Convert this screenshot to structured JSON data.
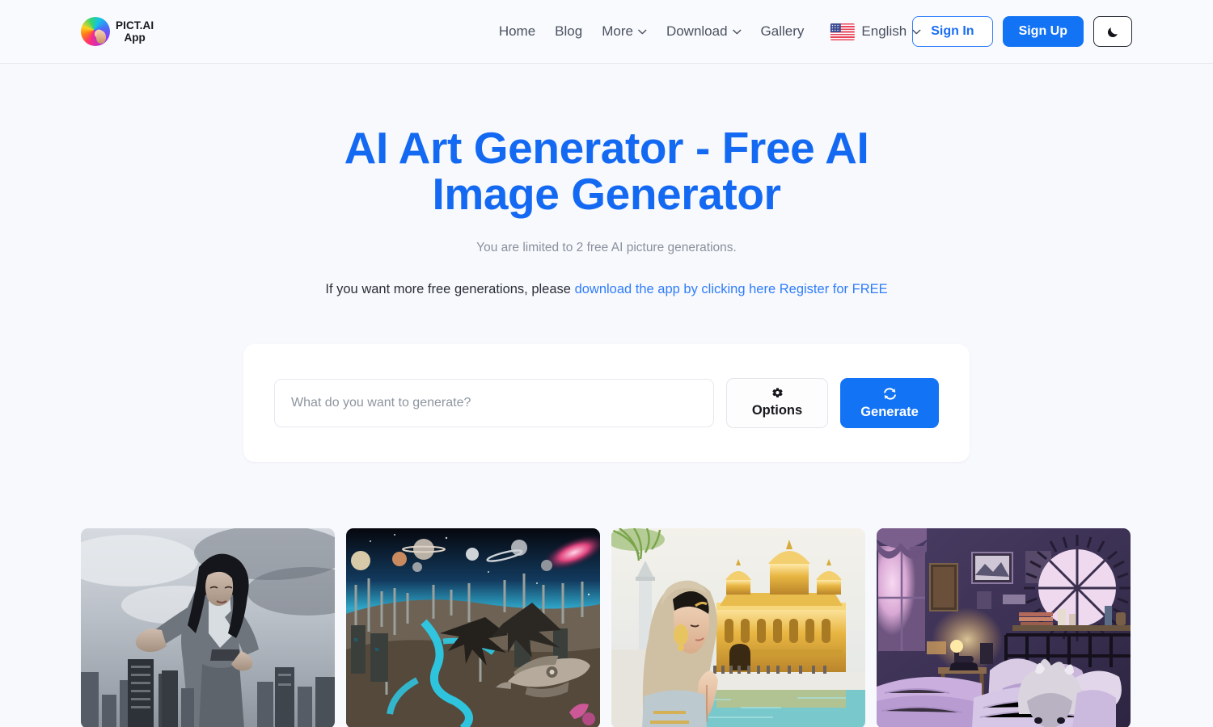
{
  "header": {
    "brand": {
      "line1": "PICT.AI",
      "line2": "App",
      "logo_icon": "pictai-avatar-logo"
    },
    "nav": [
      {
        "label": "Home",
        "has_caret": false
      },
      {
        "label": "Blog",
        "has_caret": false
      },
      {
        "label": "More",
        "has_caret": true
      },
      {
        "label": "Download",
        "has_caret": true
      },
      {
        "label": "Gallery",
        "has_caret": false
      }
    ],
    "language": {
      "label": "English",
      "flag_icon": "us-flag-icon",
      "caret_icon": "chevron-down-icon"
    },
    "sign_in_label": "Sign In",
    "sign_up_label": "Sign Up",
    "theme_toggle_icon": "moon-icon"
  },
  "hero": {
    "title": "AI Art Generator - Free AI Image Generator",
    "subtitle": "You are limited to 2 free AI picture generations.",
    "note_prefix": "If you want more free generations, please ",
    "note_link_1": "download the app by clicking here",
    "note_link_2": "Register for FREE"
  },
  "generator": {
    "prompt_value": "",
    "prompt_placeholder": "What do you want to generate?",
    "options_label": "Options",
    "options_icon": "gear-icon",
    "generate_label": "Generate",
    "generate_icon": "refresh-icon"
  },
  "gallery": {
    "items": [
      {
        "name": "giant-woman-over-city",
        "alt": "Giant woman reaching over a stormy city skyline"
      },
      {
        "name": "alien-planet-spacecraft",
        "alt": "Alien planet with spires, blue rivers and spacecraft"
      },
      {
        "name": "woman-praying-golden-temple",
        "alt": "Woman praying in front of the Golden Temple"
      },
      {
        "name": "purple-bedroom-dog",
        "alt": "Purple lit bedroom with a fluffy dog on the bed"
      }
    ]
  },
  "colors": {
    "accent_blue": "#1273f5",
    "heading_blue": "#1369f2",
    "link_blue": "#2f7dfb",
    "page_bg": "#f8f9fd",
    "panel_bg": "#ffffff",
    "muted_text": "#8a909d"
  }
}
